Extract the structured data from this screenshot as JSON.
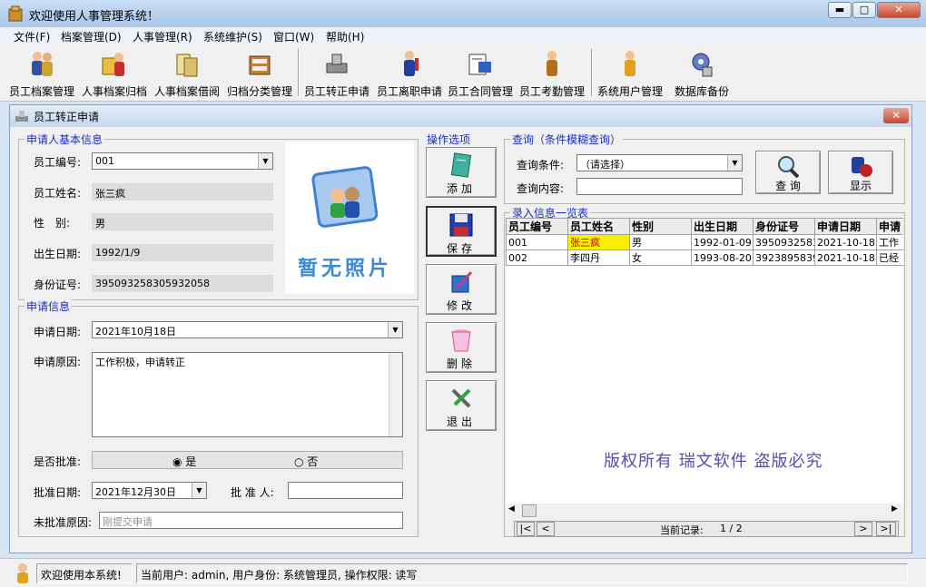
{
  "app": {
    "title": "欢迎使用人事管理系统！",
    "window_controls": {
      "minimize": "▬",
      "maximize": "□",
      "close": "✕"
    }
  },
  "menu": [
    "文件(F)",
    "档案管理(D)",
    "人事管理(R)",
    "系统维护(S)",
    "窗口(W)",
    "帮助(H)"
  ],
  "toolbar": [
    {
      "label": "员工档案管理",
      "icon": "people-icon"
    },
    {
      "label": "人事档案归档",
      "icon": "archive-people-icon"
    },
    {
      "label": "人事档案借阅",
      "icon": "borrow-icon"
    },
    {
      "label": "归档分类管理",
      "icon": "file-cabinet-icon"
    },
    {
      "label": "员工转正申请",
      "icon": "stamp-icon"
    },
    {
      "label": "员工离职申请",
      "icon": "person-leave-icon"
    },
    {
      "label": "员工合同管理",
      "icon": "contract-icon"
    },
    {
      "label": "员工考勤管理",
      "icon": "attendance-icon"
    },
    {
      "label": "系统用户管理",
      "icon": "user-icon"
    },
    {
      "label": "数据库备份",
      "icon": "database-gear-icon"
    }
  ],
  "child": {
    "title": "员工转正申请",
    "close": "✕"
  },
  "basic": {
    "group_title": "申请人基本信息",
    "emp_no_label": "员工编号:",
    "emp_no": "001",
    "name_label": "员工姓名:",
    "name": "张三疯",
    "gender_label": "性　别:",
    "gender": "男",
    "birth_label": "出生日期:",
    "birth": "1992/1/9",
    "id_label": "身份证号:",
    "id_no": "395093258305932058",
    "photo_text": "暂无照片"
  },
  "apply": {
    "group_title": "申请信息",
    "date_label": "申请日期:",
    "date": "2021年10月18日",
    "reason_label": "申请原因:",
    "reason": "工作积极，申请转正",
    "approved_label": "是否批准:",
    "yes": "是",
    "no": "否",
    "approve_date_label": "批准日期:",
    "approve_date": "2021年12月30日",
    "approver_label": "批 准 人:",
    "approver": "",
    "reject_label": "未批准原因:",
    "reject_placeholder": "刚提交申请"
  },
  "ops": {
    "group_title": "操作选项",
    "add": "添加",
    "save": "保存",
    "edit": "修改",
    "delete": "删除",
    "exit": "退出"
  },
  "query": {
    "group_title": "查询（条件模糊查询）",
    "cond_label": "查询条件:",
    "cond_value": "（请选择）",
    "content_label": "查询内容:",
    "content_value": "",
    "search_btn": "查 询",
    "display_btn": "显示"
  },
  "list": {
    "group_title": "录入信息一览表",
    "columns": [
      "员工编号",
      "员工姓名",
      "性别",
      "出生日期",
      "身份证号",
      "申请日期",
      "申请"
    ],
    "rows": [
      [
        "001",
        "张三疯",
        "男",
        "1992-01-09",
        "3950932583(",
        "2021-10-18",
        "工作"
      ],
      [
        "002",
        "李四丹",
        "女",
        "1993-08-20",
        "3923895839(",
        "2021-10-18",
        "已经"
      ]
    ],
    "watermark": "版权所有 瑞文软件 盗版必究",
    "record_label": "当前记录:",
    "record_value": "1 / 2",
    "nav_first": "|<",
    "nav_prev": "<",
    "nav_next": ">",
    "nav_last": ">|"
  },
  "status": {
    "welcome": "欢迎使用本系统!",
    "user": "当前用户: admin, 用户身份: 系统管理员, 操作权限: 读写"
  }
}
